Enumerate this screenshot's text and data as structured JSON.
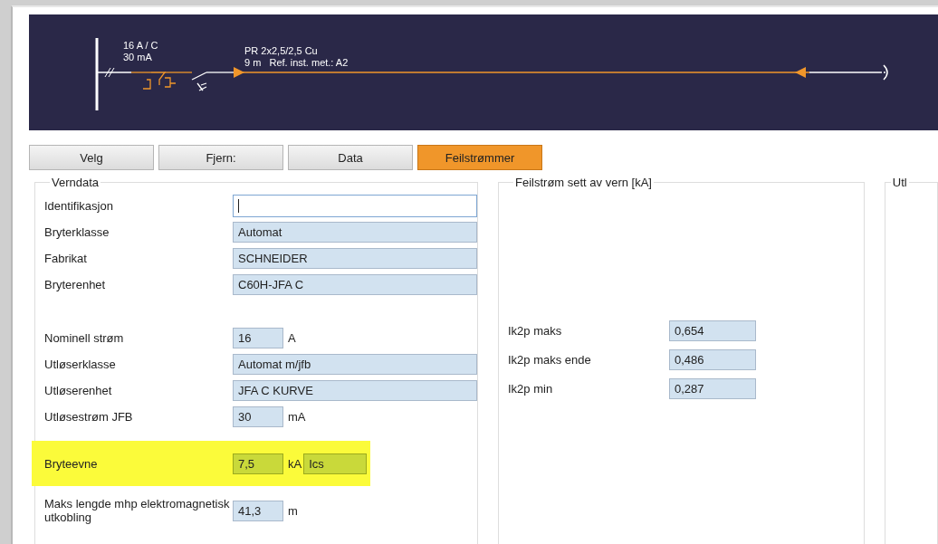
{
  "diagram": {
    "breaker_rating": "16 A / C",
    "rcd_rating": "30 mA",
    "cable_type": "PR 2x2,5/2,5 Cu",
    "cable_info": "9 m   Ref. inst. met.: A2"
  },
  "tabs": [
    {
      "label": "Velg",
      "selected": false
    },
    {
      "label": "Fjern:",
      "selected": false
    },
    {
      "label": "Data",
      "selected": false
    },
    {
      "label": "Feilstrømmer",
      "selected": true
    }
  ],
  "verndata": {
    "title": "Verndata",
    "rows": [
      {
        "label": "Identifikasjon",
        "kind": "wide",
        "value": "",
        "focused": true,
        "highlighted": false
      },
      {
        "label": "Bryterklasse",
        "kind": "wide",
        "value": "Automat",
        "focused": false,
        "highlighted": false
      },
      {
        "label": "Fabrikat",
        "kind": "wide",
        "value": "SCHNEIDER",
        "focused": false,
        "highlighted": false
      },
      {
        "label": "Bryterenhet",
        "kind": "wide",
        "value": "C60H-JFA C",
        "focused": false,
        "highlighted": false
      },
      {
        "label": "Nominell strøm",
        "kind": "short",
        "value": "16",
        "unit": "A",
        "focused": false,
        "highlighted": false
      },
      {
        "label": "Utløserklasse",
        "kind": "wide",
        "value": "Automat m/jfb",
        "focused": false,
        "highlighted": false
      },
      {
        "label": "Utløserenhet",
        "kind": "wide",
        "value": "JFA C KURVE",
        "focused": false,
        "highlighted": false
      },
      {
        "label": "Utløsestrøm JFB",
        "kind": "short",
        "value": "30",
        "unit": "mA",
        "focused": false,
        "highlighted": false
      },
      {
        "label": "Bryteevne",
        "kind": "short",
        "value": "7,5",
        "unit": "kA",
        "extra": "Ics",
        "focused": false,
        "highlighted": true
      },
      {
        "label": "Maks lengde mhp elektromagnetisk utkobling",
        "kind": "short",
        "value": "41,3",
        "unit": "m",
        "focused": false,
        "highlighted": false
      }
    ]
  },
  "feilstrom": {
    "title": "Feilstrøm sett av vern [kA]",
    "rows": [
      {
        "label": "Ik2p maks",
        "value": "0,654"
      },
      {
        "label": "Ik2p maks ende",
        "value": "0,486"
      },
      {
        "label": "Ik2p min",
        "value": "0,287"
      }
    ]
  },
  "side_group": {
    "title": "Utl"
  }
}
